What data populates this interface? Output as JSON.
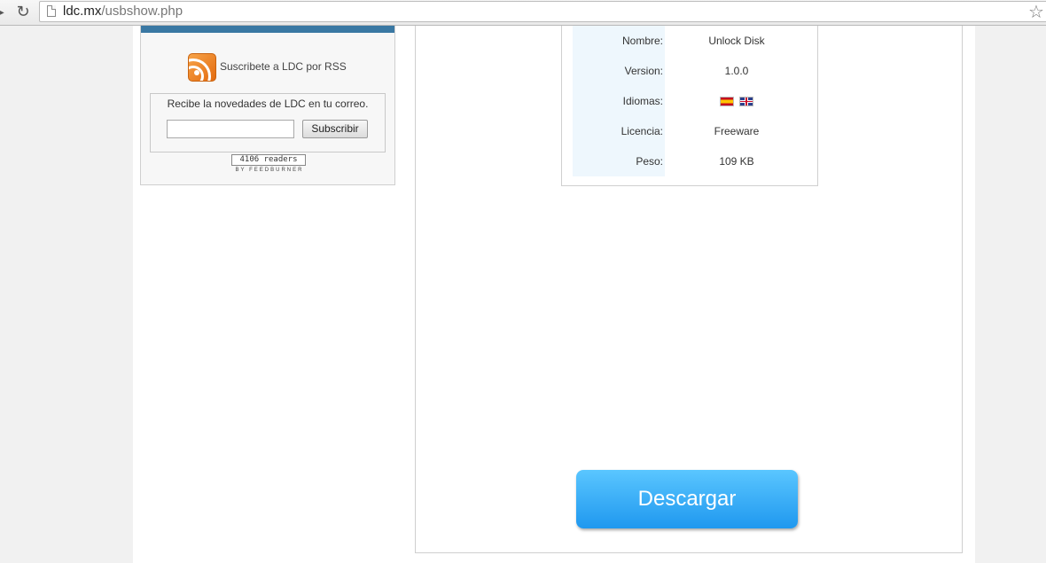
{
  "browser": {
    "url_host": "ldc.mx",
    "url_path": "/usbshow.php"
  },
  "sidebar": {
    "rss_label": "Suscribete a LDC por RSS",
    "newsletter_text": "Recibe la novedades de LDC en tu correo.",
    "email_value": "",
    "subscribe_label": "Subscribir",
    "readers_count": "4106 readers",
    "feedburner_label": "BY FEEDBURNER"
  },
  "info": {
    "rows": [
      {
        "label": "Nombre:",
        "value": "Unlock Disk"
      },
      {
        "label": "Version:",
        "value": "1.0.0"
      },
      {
        "label": "Idiomas:",
        "flags": [
          "es-flag-icon",
          "gb-flag-icon"
        ]
      },
      {
        "label": "Licencia:",
        "value": "Freeware"
      },
      {
        "label": "Peso:",
        "value": "109 KB"
      }
    ]
  },
  "download": {
    "label": "Descargar",
    "color": "#2aa6f5"
  },
  "colors": {
    "sidebar_bar": "#3a78a3",
    "label_bg": "#eef7fd"
  }
}
